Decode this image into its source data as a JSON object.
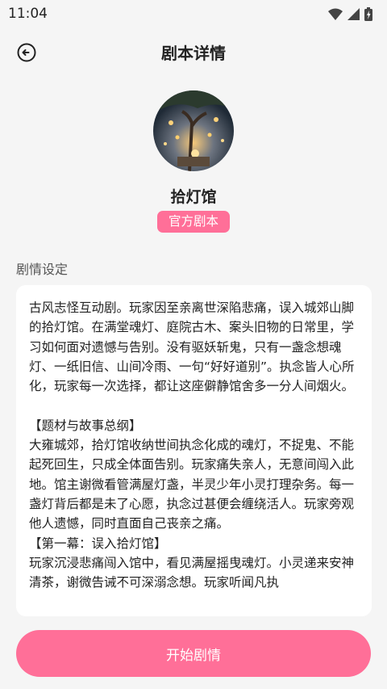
{
  "status_bar": {
    "time": "11:04"
  },
  "header": {
    "title": "剧本详情"
  },
  "script": {
    "name": "拾灯馆",
    "badge": "官方剧本"
  },
  "section": {
    "label": "剧情设定"
  },
  "description": "古风志怪互动剧。玩家因至亲离世深陷悲痛，误入城郊山脚的拾灯馆。在满堂魂灯、庭院古木、案头旧物的日常里，学习如何面对遗憾与告别。没有驱妖斩鬼，只有一盏念想魂灯、一纸旧信、山间冷雨、一句“好好道别”。执念皆人心所化，玩家每一次选择，都让这座僻静馆舍多一分人间烟火。\n\n【题材与故事总纲】\n大雍城郊，拾灯馆收纳世间执念化成的魂灯，不捉鬼、不能起死回生，只成全体面告别。玩家痛失亲人，无意间闯入此地。馆主谢微看管满屋灯盏，半灵少年小灵打理杂务。每一盏灯背后都是未了心愿，执念过甚便会缠绕活人。玩家旁观他人遗憾，同时直面自己丧亲之痛。\n【第一幕：误入拾灯馆】\n玩家沉浸悲痛闯入馆中，看见满屋摇曳魂灯。小灵递来安神清茶，谢微告诫不可深溺念想。玩家听闻凡执",
  "actions": {
    "start_label": "开始剧情"
  },
  "icons": {
    "back": "back-arrow-icon",
    "wifi": "wifi-icon",
    "signal": "signal-icon",
    "battery": "battery-icon"
  },
  "colors": {
    "accent": "#ff6f98",
    "background": "#f5f5f5",
    "card": "#ffffff"
  }
}
